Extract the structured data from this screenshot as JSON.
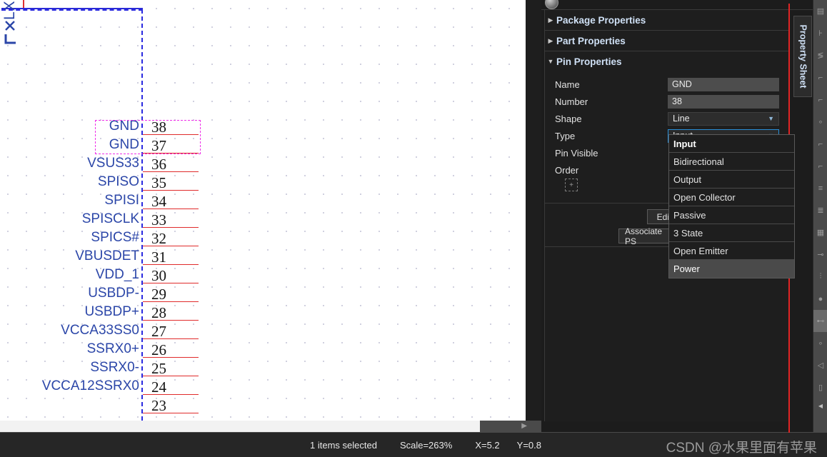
{
  "schematic": {
    "vertical_label": "LX",
    "pins": [
      {
        "name": "GND",
        "number": "38"
      },
      {
        "name": "GND",
        "number": "37"
      },
      {
        "name": "VSUS33",
        "number": "36"
      },
      {
        "name": "SPISO",
        "number": "35"
      },
      {
        "name": "SPISI",
        "number": "34"
      },
      {
        "name": "SPISCLK",
        "number": "33"
      },
      {
        "name": "SPICS#",
        "number": "32"
      },
      {
        "name": "VBUSDET",
        "number": "31"
      },
      {
        "name": "VDD_1",
        "number": "30"
      },
      {
        "name": "USBDP-",
        "number": "29"
      },
      {
        "name": "USBDP+",
        "number": "28"
      },
      {
        "name": "VCCA33SS0",
        "number": "27"
      },
      {
        "name": "SSRX0+",
        "number": "26"
      },
      {
        "name": "SSRX0-",
        "number": "25"
      },
      {
        "name": "VCCA12SSRX0",
        "number": "24"
      },
      {
        "name": "",
        "number": "23"
      }
    ],
    "colors": {
      "pin_name": "#2b46a8",
      "pin_line": "#e02b2b",
      "pin_number": "#151515",
      "body_outline": "#2b2bd6",
      "selection": "#ef2ee8"
    }
  },
  "property_sheet": {
    "tab_label": "Property Sheet",
    "sections": [
      {
        "title": "Package Properties",
        "expanded": false,
        "icon": "chevron-right-icon"
      },
      {
        "title": "Part Properties",
        "expanded": false,
        "icon": "chevron-right-icon"
      },
      {
        "title": "Pin Properties",
        "expanded": true,
        "icon": "chevron-down-icon"
      }
    ],
    "fields": [
      {
        "label": "Name",
        "value": "GND",
        "kind": "text"
      },
      {
        "label": "Number",
        "value": "38",
        "kind": "text"
      },
      {
        "label": "Shape",
        "value": "Line",
        "kind": "combo"
      },
      {
        "label": "Type",
        "value": "Input",
        "kind": "combo",
        "focused": true
      },
      {
        "label": "Pin Visible",
        "value": "",
        "kind": "none"
      },
      {
        "label": "Order",
        "value": "",
        "kind": "none"
      }
    ],
    "order_add_icon": "add-box-icon",
    "buttons": [
      {
        "label": "Edit"
      },
      {
        "label": "Associate PS"
      }
    ]
  },
  "type_dropdown": {
    "options": [
      {
        "label": "Input",
        "selected": true,
        "hovered": false
      },
      {
        "label": "Bidirectional",
        "selected": false,
        "hovered": false
      },
      {
        "label": "Output",
        "selected": false,
        "hovered": false
      },
      {
        "label": "Open Collector",
        "selected": false,
        "hovered": false
      },
      {
        "label": "Passive",
        "selected": false,
        "hovered": false
      },
      {
        "label": "3 State",
        "selected": false,
        "hovered": false
      },
      {
        "label": "Open Emitter",
        "selected": false,
        "hovered": false
      },
      {
        "label": "Power",
        "selected": false,
        "hovered": true
      }
    ]
  },
  "status_bar": {
    "selection": "1 items selected",
    "scale": "Scale=263%",
    "x": "X=5.2",
    "y": "Y=0.8"
  },
  "watermark": "CSDN @水果里面有苹果",
  "toolbar_rail": {
    "icons": [
      "ic-chip",
      "ic-port",
      "ic-netsplit",
      "ic-wire-corner",
      "ic-bus-corner",
      "ic-junction",
      "ic-wire-l",
      "ic-wire-l2",
      "ic-bar",
      "ic-bars",
      "ic-grid",
      "ic-pin",
      "ic-dip",
      "ic-dot",
      "ic-power",
      "ic-node",
      "ic-arrow-left",
      "ic-rect"
    ]
  }
}
